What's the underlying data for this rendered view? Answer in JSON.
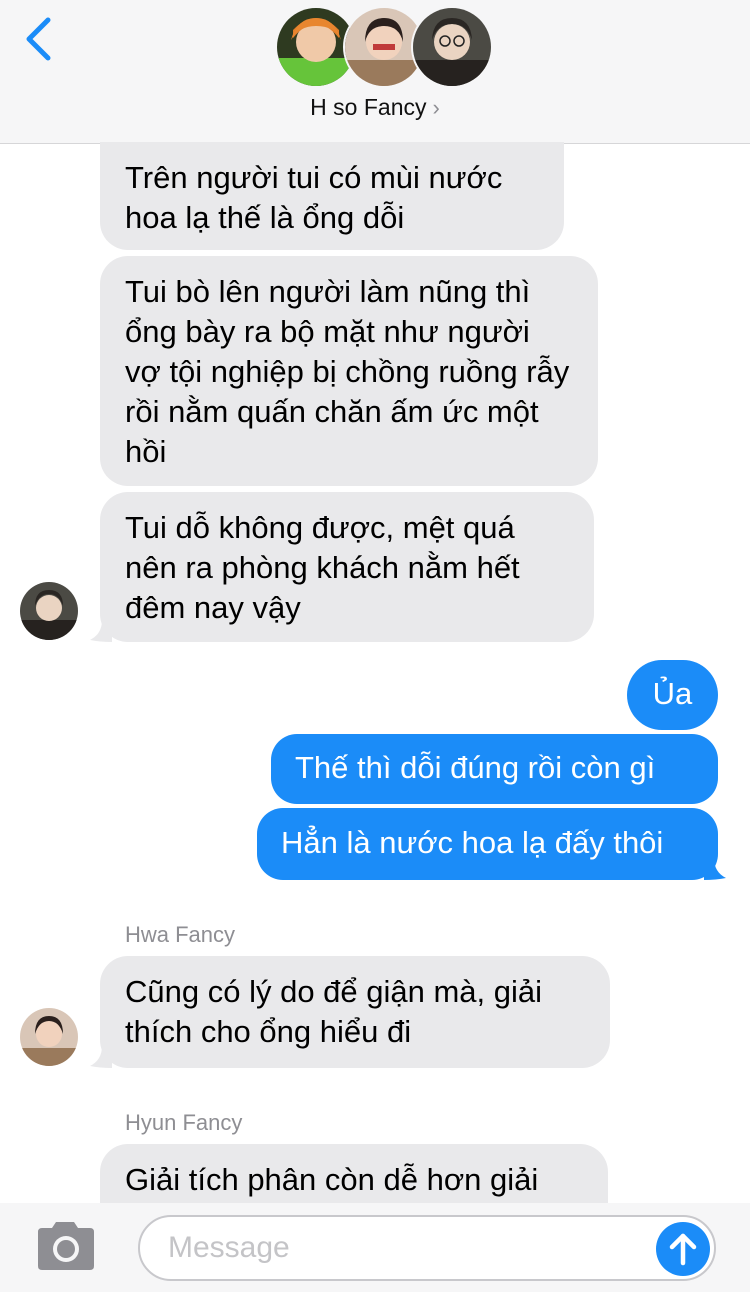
{
  "header": {
    "back_icon": "chevron-left-icon",
    "group_name": "H so Fancy",
    "chevron": "›",
    "accent": "#1b8cf8"
  },
  "messages": [
    {
      "dir": "in",
      "text": "Trên người tui có mùi nước hoa lạ thế là ổng dỗi"
    },
    {
      "dir": "in",
      "text": "Tui bò lên người làm nũng thì ổng bày ra bộ mặt như người vợ tội nghiệp bị chồng ruồng rẫy rồi nằm quấn chăn ấm ức một hồi"
    },
    {
      "dir": "in",
      "text": "Tui dỗ không được, mệt quá nên ra phòng khách nằm hết đêm nay vậy"
    },
    {
      "dir": "out",
      "text": "Ủa"
    },
    {
      "dir": "out",
      "text": "Thế thì dỗi đúng rồi còn gì"
    },
    {
      "dir": "out",
      "text": "Hẳn là nước hoa lạ đấy thôi"
    },
    {
      "dir": "in",
      "sender": "Hwa Fancy",
      "text": "Cũng có lý do để giận mà, giải thích cho ổng hiểu đi"
    },
    {
      "dir": "in",
      "sender": "Hyun Fancy",
      "text": "Giải tích phân còn dễ hơn giải"
    }
  ],
  "input": {
    "placeholder": "Message",
    "camera_icon": "camera-icon",
    "send_icon": "arrow-up-icon"
  }
}
